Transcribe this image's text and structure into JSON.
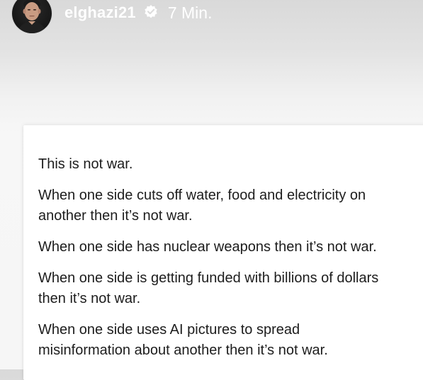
{
  "story": {
    "username": "elghazi21",
    "verified_icon": "verified-badge-icon",
    "timestamp": "7 Min."
  },
  "post": {
    "paragraphs": [
      "This is not war.",
      "When one side cuts off water, food and electricity on\nanother then it’s not war.",
      "When one side has nuclear weapons then it’s not war.",
      "When one side is getting funded with billions of dollars\nthen it’s not war.",
      "When one side uses AI pictures to spread\nmisinformation about another then it’s not war."
    ]
  },
  "colors": {
    "text": "#1d1d1d",
    "header_text": "#ffffff",
    "card_background": "#ffffff"
  }
}
